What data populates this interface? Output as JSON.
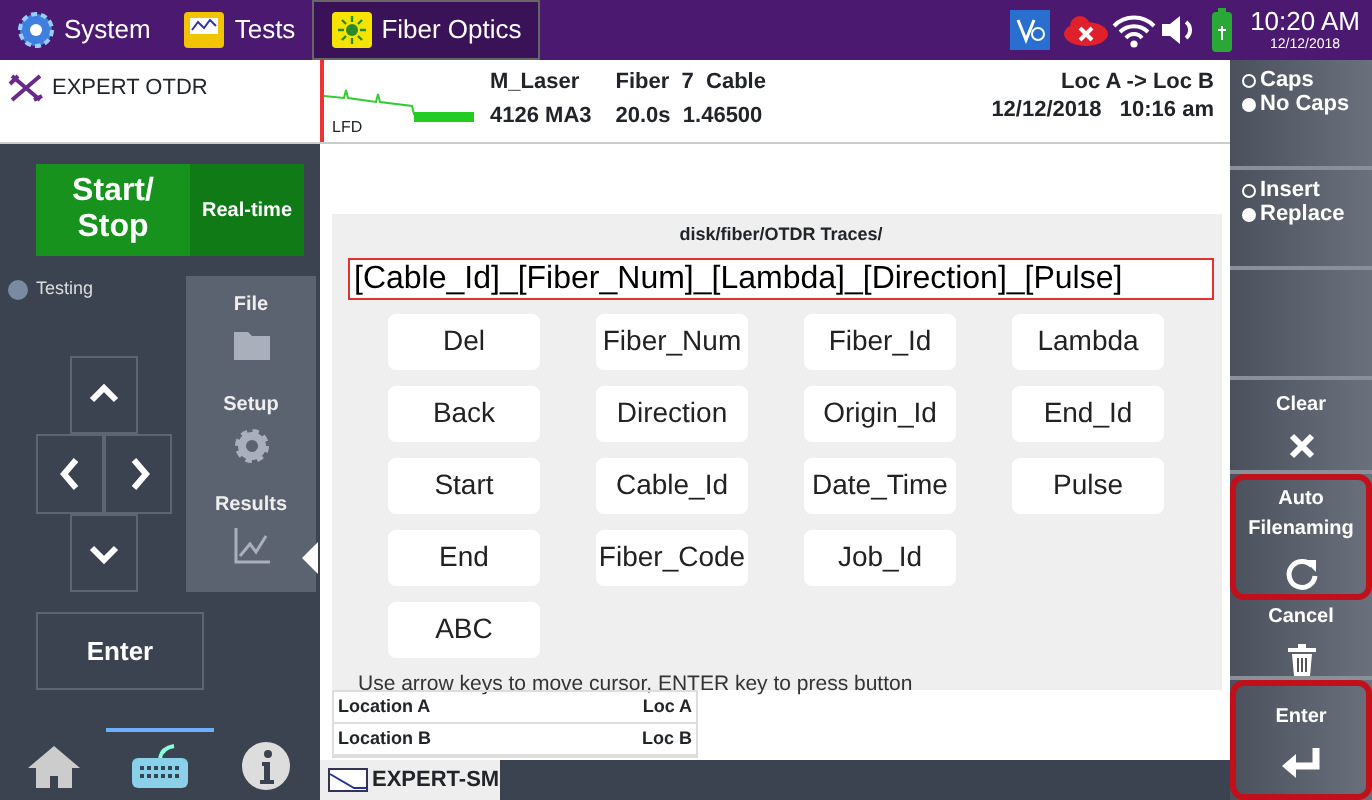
{
  "top_bar": {
    "tabs": [
      {
        "label": "System",
        "selected": false
      },
      {
        "label": "Tests",
        "selected": false
      },
      {
        "label": "Fiber Optics",
        "selected": true
      }
    ],
    "time": "10:20 AM",
    "date": "12/12/2018"
  },
  "header": {
    "title": "EXPERT OTDR",
    "trace_label": "LFD",
    "info_left": [
      [
        "M_Laser",
        "Fiber  7  Cable"
      ],
      [
        "4126 MA3",
        "20.0s  1.46500"
      ]
    ],
    "info_right": [
      "Loc A -> Loc B",
      "12/12/2018   10:16 am"
    ]
  },
  "left_panel": {
    "start_stop": "Start/ Stop",
    "realtime": "Real-time",
    "status": {
      "label": "Testing",
      "on": false
    },
    "menu": [
      {
        "label": "File",
        "kind": "folder",
        "selected": false
      },
      {
        "label": "Setup",
        "kind": "gear",
        "selected": false
      },
      {
        "label": "Results",
        "kind": "chart",
        "selected": true
      }
    ],
    "enter": "Enter",
    "dock": [
      {
        "kind": "home",
        "selected": false
      },
      {
        "kind": "keyboard",
        "selected": true
      },
      {
        "kind": "info",
        "selected": false
      }
    ]
  },
  "dialog": {
    "path": "disk/fiber/OTDR Traces/",
    "filename": "[Cable_Id]_[Fiber_Num]_[Lambda]_[Direction]_[Pulse]",
    "keys": [
      [
        "Del",
        "Fiber_Num",
        "Fiber_Id",
        "Lambda"
      ],
      [
        "Back",
        "Direction",
        "Origin_Id",
        "End_Id"
      ],
      [
        "Start",
        "Cable_Id",
        "Date_Time",
        "Pulse"
      ],
      [
        "End",
        "Fiber_Code",
        "Job_Id"
      ],
      [
        "ABC"
      ]
    ],
    "hint": "Use arrow keys to move cursor, ENTER key to press button"
  },
  "locations": [
    {
      "label": "Location A",
      "value": "Loc A"
    },
    {
      "label": "Location B",
      "value": "Loc B"
    }
  ],
  "bottom_tab": "EXPERT-SM",
  "right_panel": {
    "case_options": [
      {
        "label": "Caps",
        "selected": false
      },
      {
        "label": "No Caps",
        "selected": true
      }
    ],
    "mode_options": [
      {
        "label": "Insert",
        "selected": false
      },
      {
        "label": "Replace",
        "selected": true
      }
    ],
    "actions": [
      {
        "label": "Clear",
        "kind": "clear",
        "highlighted": false
      },
      {
        "label": "Auto Filenaming",
        "kind": "auto",
        "highlighted": true
      },
      {
        "label": "Cancel",
        "kind": "cancel",
        "highlighted": false
      },
      {
        "label": "Enter",
        "kind": "enter",
        "highlighted": true
      }
    ]
  }
}
